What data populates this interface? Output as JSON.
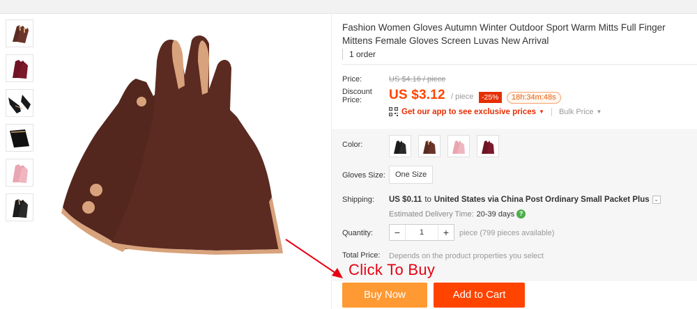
{
  "product": {
    "title": "Fashion Women Gloves Autumn Winter Outdoor Sport Warm Mitts Full Finger Mittens Female Gloves Screen Luvas New Arrival",
    "orders": "1 order"
  },
  "price": {
    "label": "Price:",
    "original": "US $4.16 / piece",
    "discount_label": "Discount Price:",
    "current": "US $3.12",
    "unit": "/ piece",
    "discount_badge": "-25%",
    "countdown": "18h:34m:48s",
    "app_promo": "Get our app to see exclusive prices",
    "bulk_price": "Bulk Price"
  },
  "options": {
    "color_label": "Color:",
    "colors": [
      {
        "icon": "black-glove-icon",
        "hex": "#1c1c1c"
      },
      {
        "icon": "brown-glove-icon",
        "hex": "#5a2b22"
      },
      {
        "icon": "pink-glove-icon",
        "hex": "#e8a6b2"
      },
      {
        "icon": "wine-glove-icon",
        "hex": "#6e1424"
      }
    ],
    "size_label": "Gloves Size:",
    "size_value": "One Size"
  },
  "shipping": {
    "label": "Shipping:",
    "cost": "US $0.11",
    "to_word": "to",
    "destination": "United States via China Post Ordinary Small Packet Plus",
    "delivery_label": "Estimated Delivery Time:",
    "delivery_days": "20-39 days"
  },
  "quantity": {
    "label": "Quantity:",
    "minus": "−",
    "value": "1",
    "plus": "+",
    "available": "piece (799 pieces available)"
  },
  "total": {
    "label": "Total Price:",
    "note": "Depends on the product properties you select"
  },
  "annotation": {
    "text": "Click To Buy"
  },
  "actions": {
    "buy_now": "Buy Now",
    "add_to_cart": "Add to Cart"
  },
  "colors": {
    "accent": "#ff4400",
    "buy_now_bg": "#ff9933",
    "discount_red": "#e62e04",
    "glove_brown": "#5a2b22",
    "glove_trim": "#d8a37c"
  }
}
